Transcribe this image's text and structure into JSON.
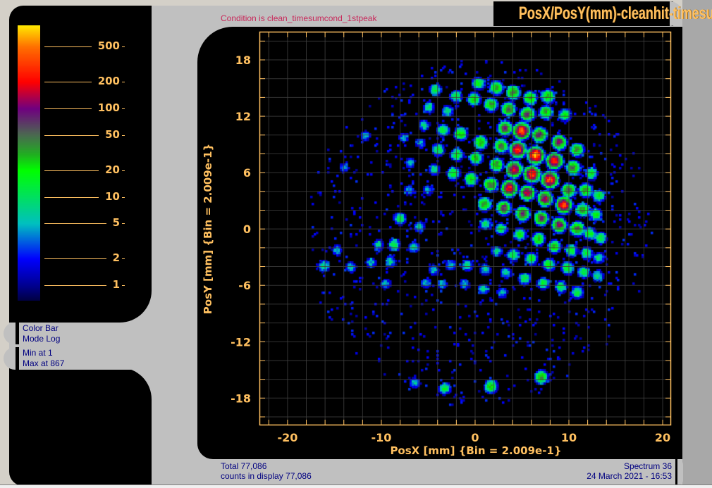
{
  "title": "PosX/PosY(mm)-cleanhit-timesum",
  "condition": "Condition is clean_timesumcond_1stpeak",
  "colorbar": {
    "mode_lines": [
      "Color Bar",
      "Mode Log"
    ],
    "minmax_lines": [
      "Min at 1",
      "Max at 867"
    ],
    "ticks": [
      {
        "value": 500,
        "label": "500"
      },
      {
        "value": 200,
        "label": "200"
      },
      {
        "value": 100,
        "label": "100"
      },
      {
        "value": 50,
        "label": "50"
      },
      {
        "value": 20,
        "label": "20"
      },
      {
        "value": 10,
        "label": "10"
      },
      {
        "value": 5,
        "label": "5"
      },
      {
        "value": 2,
        "label": "2"
      },
      {
        "value": 1,
        "label": "1"
      }
    ],
    "range": [
      0.67,
      867
    ],
    "stops": [
      [
        0.67,
        "#000040"
      ],
      [
        1,
        "#000090"
      ],
      [
        2,
        "#0000ff"
      ],
      [
        5,
        "#00c0c0"
      ],
      [
        10,
        "#00e060"
      ],
      [
        20,
        "#00ff00"
      ],
      [
        30,
        "#20b020"
      ],
      [
        50,
        "#4a6a50"
      ],
      [
        100,
        "#700080"
      ],
      [
        200,
        "#ff0000"
      ],
      [
        500,
        "#ff7000"
      ],
      [
        867,
        "#ffe800"
      ]
    ]
  },
  "footer": {
    "total": "Total 77,086",
    "counts": "counts in display 77,086",
    "spectrum": "Spectrum 36",
    "date": "24 March 2021 - 16:53"
  },
  "colors": {
    "axis": "#ffc060",
    "grid": "#404040"
  },
  "chart_data": {
    "type": "heatmap",
    "xlabel": "PosX [mm] {Bin = 2.009e-1}",
    "ylabel": "PosY [mm] {Bin = 2.009e-1}",
    "xlim": [
      -23.0,
      20.9
    ],
    "ylim": [
      -20.9,
      21.0
    ],
    "bin": 0.2009,
    "xticks": [
      -20,
      -10,
      0,
      10,
      20
    ],
    "yticks": [
      18,
      12,
      6,
      0,
      -6,
      -12,
      -18
    ],
    "grid": true,
    "grid_step": 2,
    "scale": "log",
    "spots": [
      [
        5.0,
        10.4,
        500
      ],
      [
        4.6,
        8.4,
        350
      ],
      [
        6.5,
        7.8,
        700
      ],
      [
        8.5,
        7.2,
        350
      ],
      [
        4.2,
        6.3,
        250
      ],
      [
        6.1,
        5.8,
        350
      ],
      [
        8.0,
        5.2,
        450
      ],
      [
        3.7,
        4.3,
        250
      ],
      [
        5.6,
        3.8,
        150
      ],
      [
        7.5,
        3.2,
        150
      ],
      [
        9.5,
        2.5,
        350
      ],
      [
        3.1,
        2.2,
        80
      ],
      [
        5.1,
        1.6,
        80
      ],
      [
        7.1,
        1.1,
        80
      ],
      [
        9.0,
        0.4,
        100
      ],
      [
        10.9,
        0,
        60
      ],
      [
        1.7,
        4.7,
        60
      ],
      [
        -0.4,
        5.3,
        30
      ],
      [
        1.0,
        2.6,
        40
      ],
      [
        2.3,
        6.8,
        50
      ],
      [
        2.8,
        8.8,
        60
      ],
      [
        3.2,
        10.7,
        80
      ],
      [
        3.6,
        12.7,
        60
      ],
      [
        4.1,
        14.5,
        50
      ],
      [
        5.9,
        13.9,
        40
      ],
      [
        7.8,
        14.1,
        40
      ],
      [
        5.6,
        12.2,
        80
      ],
      [
        7.6,
        12.4,
        40
      ],
      [
        6.9,
        10.0,
        100
      ],
      [
        9.0,
        9.2,
        100
      ],
      [
        9.6,
        12.1,
        20
      ],
      [
        10.9,
        8.4,
        40
      ],
      [
        10.5,
        6.5,
        60
      ],
      [
        12.4,
        5.9,
        20
      ],
      [
        10.0,
        4.1,
        60
      ],
      [
        11.8,
        4.1,
        40
      ],
      [
        13.2,
        3.5,
        20
      ],
      [
        11.5,
        2.0,
        40
      ],
      [
        12.9,
        1.5,
        20
      ],
      [
        12.2,
        -0.5,
        20
      ],
      [
        13.4,
        -1.0,
        15
      ],
      [
        6.8,
        -1.1,
        30
      ],
      [
        4.8,
        -0.6,
        20
      ],
      [
        2.8,
        0,
        15
      ],
      [
        1.1,
        0.5,
        10
      ],
      [
        0.6,
        9.2,
        40
      ],
      [
        0.1,
        7.5,
        30
      ],
      [
        -1.5,
        10.1,
        30
      ],
      [
        -1.9,
        7.9,
        20
      ],
      [
        -2.3,
        5.9,
        20
      ],
      [
        -3.4,
        10.5,
        15
      ],
      [
        -3.9,
        8.4,
        15
      ],
      [
        -4.3,
        6.3,
        10
      ],
      [
        -5.4,
        11,
        8
      ],
      [
        -0.1,
        13.8,
        30
      ],
      [
        0.4,
        15.5,
        20
      ],
      [
        2.3,
        15,
        40
      ],
      [
        1.7,
        13.2,
        40
      ],
      [
        -2.0,
        14.1,
        15
      ],
      [
        -4.2,
        14.8,
        15
      ],
      [
        -4.9,
        12.9,
        10
      ],
      [
        -2.9,
        12.5,
        10
      ],
      [
        8.5,
        -1.9,
        30
      ],
      [
        10.3,
        -2.3,
        20
      ],
      [
        11.9,
        -2.6,
        15
      ],
      [
        13.2,
        -3.1,
        10
      ],
      [
        6.0,
        -3.2,
        20
      ],
      [
        4.1,
        -2.8,
        15
      ],
      [
        2.3,
        -2.4,
        8
      ],
      [
        7.9,
        -3.8,
        20
      ],
      [
        9.9,
        -4.2,
        20
      ],
      [
        11.6,
        -4.6,
        15
      ],
      [
        13.1,
        -5.0,
        10
      ],
      [
        5.3,
        -5.3,
        15
      ],
      [
        3.3,
        -4.7,
        8
      ],
      [
        7.3,
        -5.8,
        15
      ],
      [
        9.2,
        -6.2,
        15
      ],
      [
        10.9,
        -6.8,
        15
      ],
      [
        1.1,
        -4.3,
        8
      ],
      [
        -0.8,
        -3.9,
        8
      ],
      [
        -2.6,
        -3.8,
        6
      ],
      [
        0.9,
        -6.4,
        8
      ],
      [
        2.9,
        -6.8,
        6
      ],
      [
        -1.1,
        -5.9,
        6
      ],
      [
        7.1,
        -15.8,
        40
      ],
      [
        1.7,
        -16.8,
        30
      ],
      [
        -3.2,
        -17.0,
        15
      ],
      [
        -6.4,
        -16.4,
        6
      ],
      [
        -8.0,
        1.1,
        15
      ],
      [
        -8.6,
        -1.7,
        15
      ],
      [
        -6.5,
        -2.0,
        8
      ],
      [
        -5.9,
        0.2,
        8
      ],
      [
        -10.3,
        -1.7,
        8
      ],
      [
        -9.0,
        -3.5,
        8
      ],
      [
        -11.1,
        -3.6,
        6
      ],
      [
        -16.1,
        -4.0,
        10
      ],
      [
        -13.2,
        -4.1,
        6
      ],
      [
        -14.7,
        -2.3,
        6
      ],
      [
        -9.5,
        -5.9,
        6
      ],
      [
        -3.5,
        -5.9,
        6
      ],
      [
        -4.4,
        -4.4,
        6
      ],
      [
        -5.2,
        -5.8,
        6
      ],
      [
        -11.7,
        9.9,
        5
      ],
      [
        -7.6,
        9.7,
        5
      ],
      [
        -5.8,
        9.1,
        5
      ],
      [
        -6.9,
        7.0,
        5
      ],
      [
        -5.0,
        4.1,
        5
      ],
      [
        -7,
        4.1,
        5
      ],
      [
        -13.9,
        6.5,
        4
      ]
    ]
  }
}
